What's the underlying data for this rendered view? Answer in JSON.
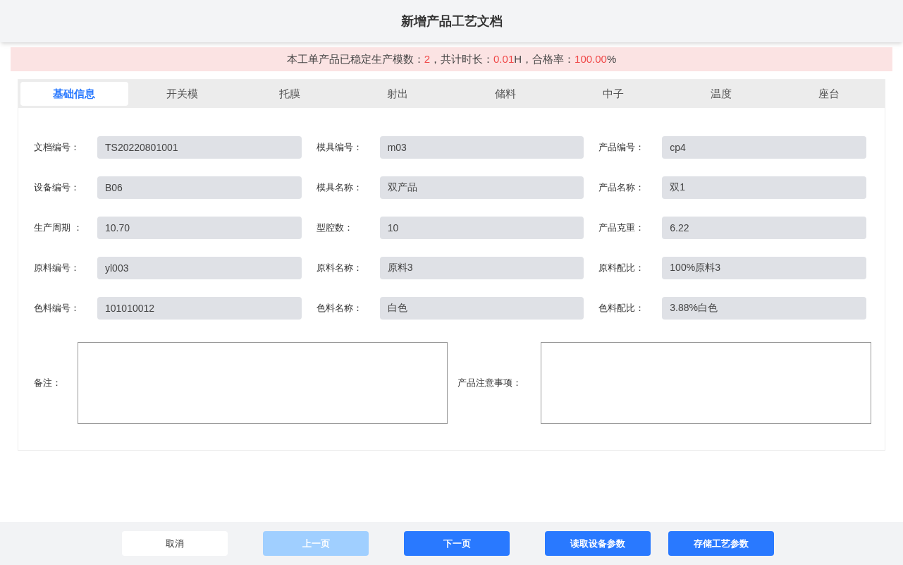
{
  "title": "新增产品工艺文档",
  "banner": [
    {
      "text": "本工单产品已稳定生产模数：",
      "highlight": false
    },
    {
      "text": "2",
      "highlight": true
    },
    {
      "text": "，共计时长：",
      "highlight": false
    },
    {
      "text": "0.01",
      "highlight": true
    },
    {
      "text": "H，合格率：",
      "highlight": false
    },
    {
      "text": "100.00",
      "highlight": true
    },
    {
      "text": "%",
      "highlight": false
    }
  ],
  "tabs": [
    {
      "label": "基础信息",
      "selected": true
    },
    {
      "label": "开关模",
      "selected": false
    },
    {
      "label": "托膜",
      "selected": false
    },
    {
      "label": "射出",
      "selected": false
    },
    {
      "label": "储料",
      "selected": false
    },
    {
      "label": "中子",
      "selected": false
    },
    {
      "label": "温度",
      "selected": false
    },
    {
      "label": "座台",
      "selected": false
    }
  ],
  "fields": [
    {
      "label": "文档编号：",
      "value": "TS20220801001"
    },
    {
      "label": "模具编号：",
      "value": "m03"
    },
    {
      "label": "产品编号：",
      "value": "cp4"
    },
    {
      "label": "设备编号：",
      "value": "B06"
    },
    {
      "label": "模具名称：",
      "value": "双产品"
    },
    {
      "label": "产品名称：",
      "value": "双1"
    },
    {
      "label": "生产周期 ：",
      "value": "10.70"
    },
    {
      "label": "型腔数：",
      "value": "10"
    },
    {
      "label": "产品克重：",
      "value": "6.22"
    },
    {
      "label": "原料编号：",
      "value": "yl003"
    },
    {
      "label": "原料名称：",
      "value": "原料3"
    },
    {
      "label": "原料配比：",
      "value": "100%原料3"
    },
    {
      "label": "色料编号：",
      "value": "101010012"
    },
    {
      "label": "色料名称：",
      "value": "白色"
    },
    {
      "label": "色料配比：",
      "value": "3.88%白色"
    }
  ],
  "notes": [
    {
      "label": "备注："
    },
    {
      "label": "产品注意事项："
    }
  ],
  "buttons": [
    {
      "label": "取消",
      "kind": "default",
      "disabled": false
    },
    {
      "label": "上一页",
      "kind": "primary",
      "disabled": true
    },
    {
      "label": "下一页",
      "kind": "primary",
      "disabled": false
    },
    {
      "label": "读取设备参数",
      "kind": "primary",
      "disabled": false
    },
    {
      "label": "存储工艺参数",
      "kind": "primary",
      "disabled": false
    }
  ]
}
